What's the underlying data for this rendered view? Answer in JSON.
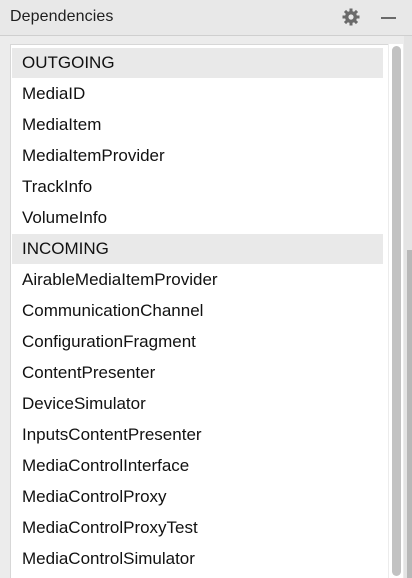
{
  "panel": {
    "title": "Dependencies",
    "gear_icon": "gear-icon",
    "minimize_icon": "minimize-icon"
  },
  "list": {
    "rows": [
      {
        "type": "section",
        "label": "OUTGOING"
      },
      {
        "type": "item",
        "label": "MediaID"
      },
      {
        "type": "item",
        "label": "MediaItem"
      },
      {
        "type": "item",
        "label": "MediaItemProvider"
      },
      {
        "type": "item",
        "label": "TrackInfo"
      },
      {
        "type": "item",
        "label": "VolumeInfo"
      },
      {
        "type": "section",
        "label": "INCOMING"
      },
      {
        "type": "item",
        "label": "AirableMediaItemProvider"
      },
      {
        "type": "item",
        "label": "CommunicationChannel"
      },
      {
        "type": "item",
        "label": "ConfigurationFragment"
      },
      {
        "type": "item",
        "label": "ContentPresenter"
      },
      {
        "type": "item",
        "label": "DeviceSimulator"
      },
      {
        "type": "item",
        "label": "InputsContentPresenter"
      },
      {
        "type": "item",
        "label": "MediaControlInterface"
      },
      {
        "type": "item",
        "label": "MediaControlProxy"
      },
      {
        "type": "item",
        "label": "MediaControlProxyTest"
      },
      {
        "type": "item",
        "label": "MediaControlSimulator"
      }
    ]
  },
  "colors": {
    "section_background": "#e9e9e9",
    "list_background": "#ffffff",
    "header_background": "#e8e8e8"
  }
}
